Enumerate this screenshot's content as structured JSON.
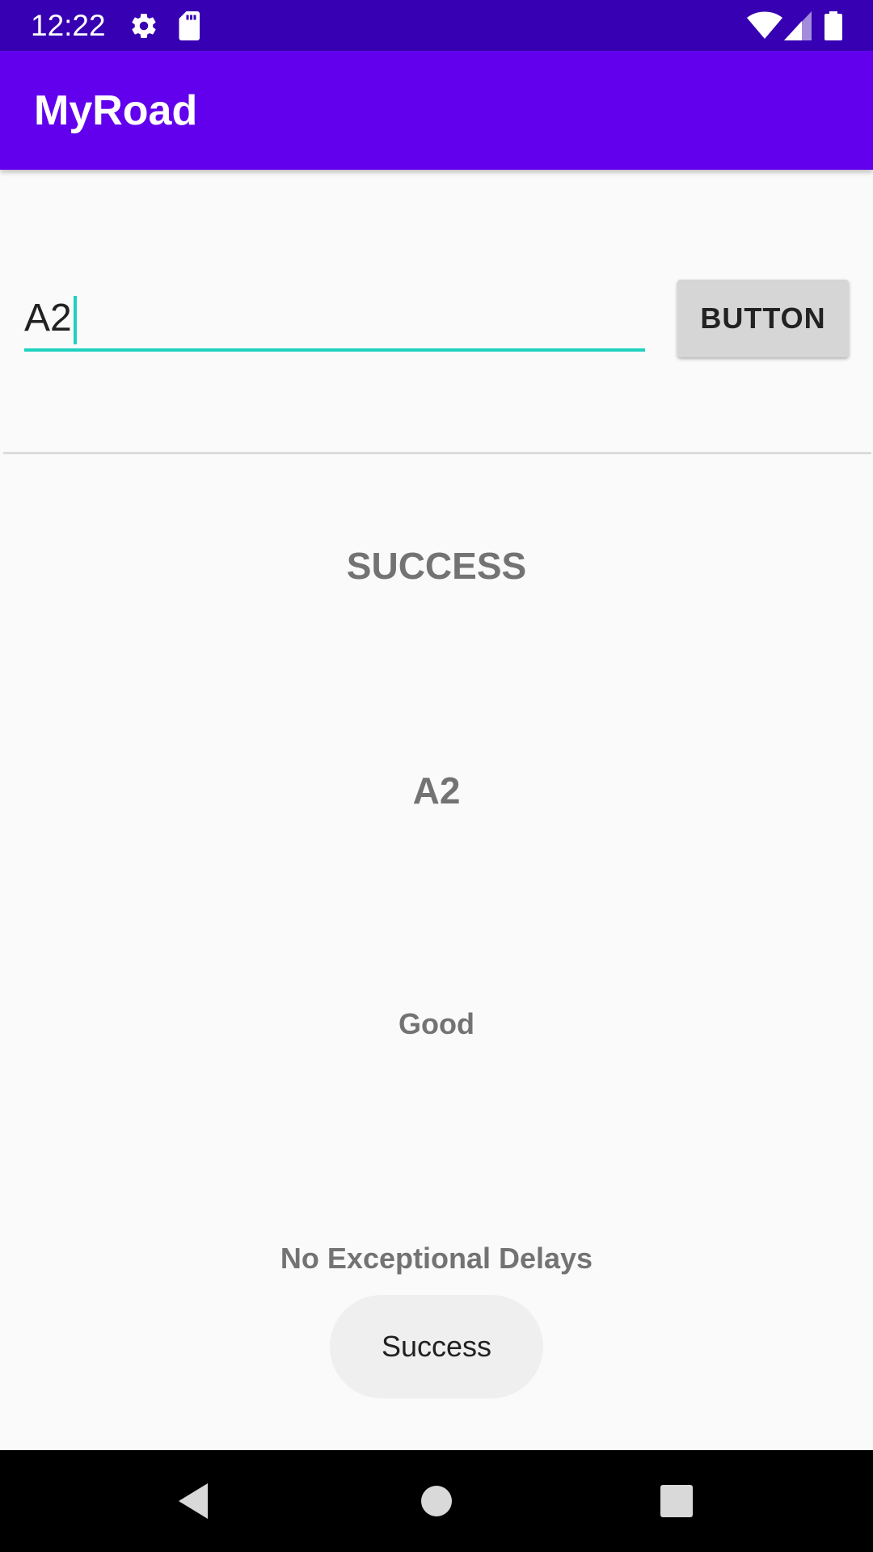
{
  "status_bar": {
    "time": "12:22",
    "icons": [
      "gear-icon",
      "sd-card-icon",
      "wifi-icon",
      "signal-icon",
      "battery-icon"
    ]
  },
  "app_bar": {
    "title": "MyRoad"
  },
  "form": {
    "input_value": "A2",
    "button_label": "BUTTON"
  },
  "result": {
    "status": "SUCCESS",
    "road": "A2",
    "quality": "Good",
    "delays": "No Exceptional Delays"
  },
  "toast": {
    "text": "Success"
  },
  "nav_bar": {
    "icons": [
      "back-icon",
      "home-icon",
      "recents-icon"
    ]
  },
  "colors": {
    "status_bar": "#3700b3",
    "app_bar": "#6200ee",
    "accent": "#1fd1c0",
    "background": "#fafafa",
    "result_text": "#737373"
  }
}
